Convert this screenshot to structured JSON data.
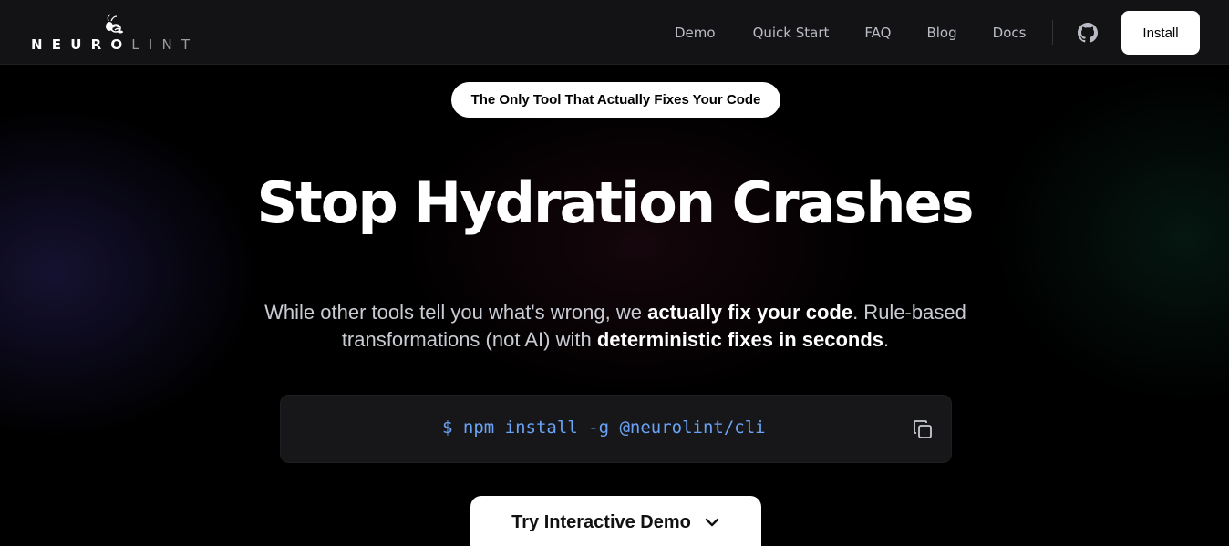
{
  "brand": {
    "wordmark_bold": "NEURO",
    "wordmark_light": "LINT"
  },
  "nav": {
    "items": [
      "Demo",
      "Quick Start",
      "FAQ",
      "Blog",
      "Docs"
    ],
    "install_label": "Install"
  },
  "hero": {
    "badge": "The Only Tool That Actually Fixes Your Code",
    "title": "Stop Hydration Crashes",
    "sub_1": "While other tools tell you what's wrong, we ",
    "sub_2": "actually fix your code",
    "sub_3": ". Rule-based transformations (not AI) with ",
    "sub_4": "deterministic fixes in seconds",
    "sub_5": ".",
    "command": "$ npm install -g @neurolint/cli",
    "demo_label": "Try Interactive Demo"
  },
  "icons": {
    "logo": "bee-icon",
    "github": "github-icon",
    "copy": "copy-icon",
    "chevron": "chevron-down-icon"
  },
  "colors": {
    "accent_code": "#6aa3f5",
    "header_bg": "#131315"
  }
}
